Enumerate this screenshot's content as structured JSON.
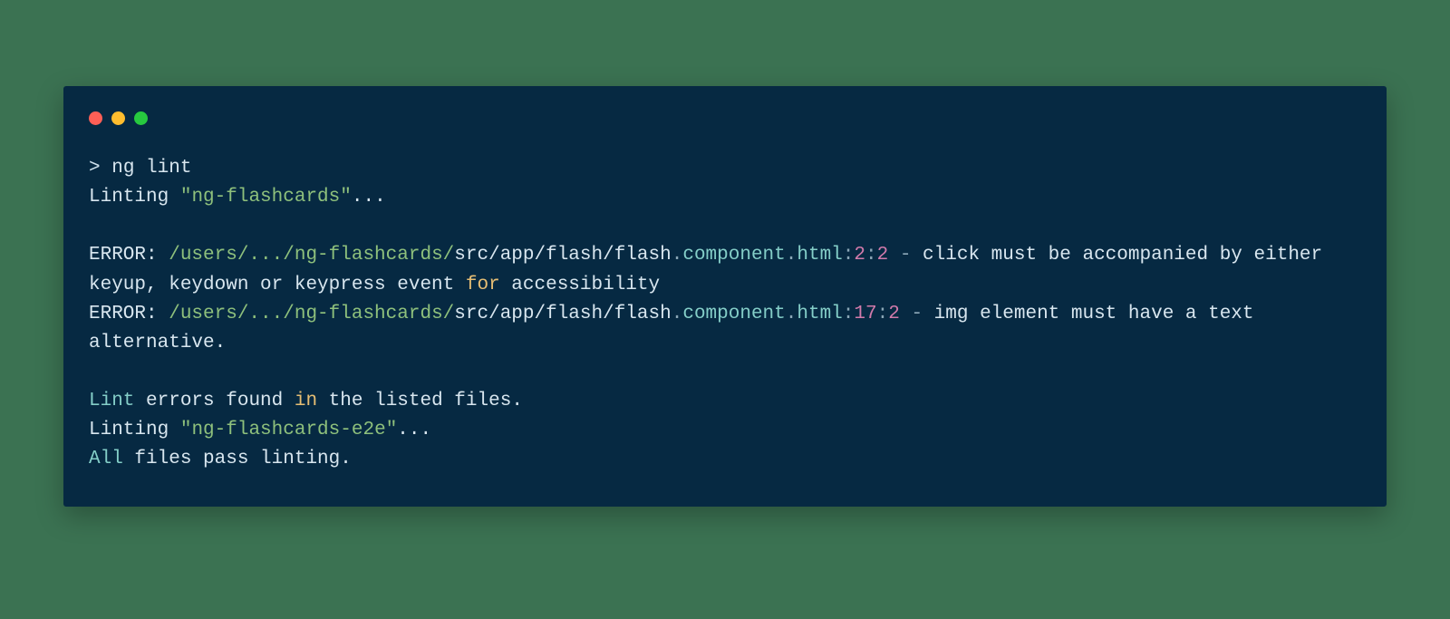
{
  "terminal": {
    "prompt": {
      "gt": ">",
      "cmd": "ng lint"
    },
    "line2": {
      "pre": "Linting ",
      "str_open": "\"",
      "str_body": "ng-flashcards",
      "str_close": "\"",
      "tail": "..."
    },
    "err1": {
      "label": "ERROR: ",
      "path_a": "/users/.../ng-flashcards/",
      "path_b": "src/app/flash/flash",
      "dot1": ".",
      "comp": "component",
      "dot2": ".",
      "ext": "html",
      "loc_colon1": ":",
      "loc_a": "2",
      "loc_colon2": ":",
      "loc_b": "2",
      "dash": " - ",
      "msg_a": "click must be accompanied by either keyup, keydown or keypress event ",
      "kw_for": "for",
      "msg_b": " accessibility"
    },
    "err2": {
      "label": "ERROR: ",
      "path_a": "/users/.../ng-flashcards/",
      "path_b": "src/app/flash/flash",
      "dot1": ".",
      "comp": "component",
      "dot2": ".",
      "ext": "html",
      "loc_colon1": ":",
      "loc_a": "17",
      "loc_colon2": ":",
      "loc_b": "2",
      "dash": " - ",
      "msg": "img element must have a text alternative."
    },
    "found": {
      "a": "Lint",
      "b": " errors found ",
      "kw_in": "in",
      "c": " the listed files."
    },
    "line8": {
      "pre": "Linting ",
      "str_open": "\"",
      "str_body": "ng-flashcards-e2e",
      "str_close": "\"",
      "tail": "..."
    },
    "pass": {
      "a": "All",
      "b": " files pass linting."
    }
  }
}
